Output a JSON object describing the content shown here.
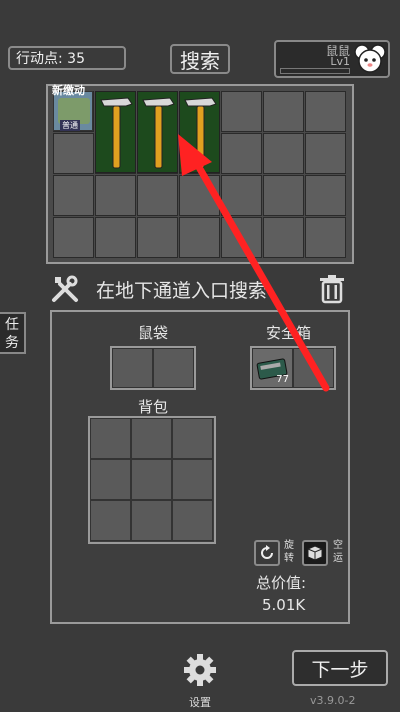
{
  "header": {
    "action_points_label": "行动点: 35",
    "search_button": "搜索",
    "player_name": "鼠鼠",
    "player_level": "Lv1"
  },
  "loot_grid": {
    "new_item_badge": "新缴动",
    "item_subtext": "普通"
  },
  "search_location": "在地下通道入口搜索",
  "side_tab": "任务",
  "inventory": {
    "pouch_label": "鼠袋",
    "safe_box_label": "安全箱",
    "safe_item_count": "77",
    "backpack_label": "背包",
    "rotate_label_1": "旋",
    "rotate_label_2": "转",
    "empty_label_1": "空",
    "empty_label_2": "运",
    "total_value_label": "总价值:",
    "total_value": "5.01K"
  },
  "footer": {
    "settings_label": "设置",
    "next_step_button": "下一步",
    "version": "v3.9.0-2"
  },
  "colors": {
    "background": "#3a3a3a",
    "item_highlight": "#1d4a1d",
    "arrow": "#ff2222",
    "hammer_handle": "#e0a020"
  }
}
